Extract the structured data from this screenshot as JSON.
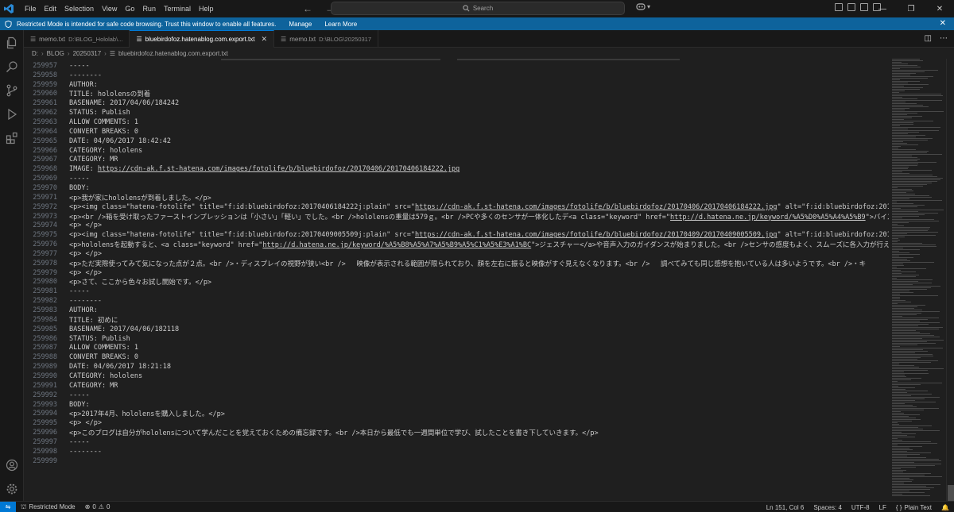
{
  "titlebar": {
    "menu": [
      "File",
      "Edit",
      "Selection",
      "View",
      "Go",
      "Run",
      "Terminal",
      "Help"
    ],
    "search_label": "Search"
  },
  "banner": {
    "text": "Restricted Mode is intended for safe code browsing. Trust this window to enable all features.",
    "manage": "Manage",
    "learn_more": "Learn More"
  },
  "tabs": [
    {
      "label": "memo.txt",
      "desc": "D:\\BLOG_Hololab\\...",
      "active": false
    },
    {
      "label": "bluebirdofoz.hatenablog.com.export.txt",
      "desc": "",
      "active": true
    },
    {
      "label": "memo.txt",
      "desc": "D:\\BLOG\\20250317",
      "active": false
    }
  ],
  "breadcrumb": [
    "D:",
    "BLOG",
    "20250317",
    "bluebirdofoz.hatenablog.com.export.txt"
  ],
  "editor": {
    "lines": [
      {
        "n": "259957",
        "t": "-----"
      },
      {
        "n": "259958",
        "t": "--------"
      },
      {
        "n": "259959",
        "t": "AUTHOR:"
      },
      {
        "n": "259960",
        "t": "TITLE: hololensの到着"
      },
      {
        "n": "259961",
        "t": "BASENAME: 2017/04/06/184242"
      },
      {
        "n": "259962",
        "t": "STATUS: Publish"
      },
      {
        "n": "259963",
        "t": "ALLOW COMMENTS: 1"
      },
      {
        "n": "259964",
        "t": "CONVERT BREAKS: 0"
      },
      {
        "n": "259965",
        "t": "DATE: 04/06/2017 18:42:42"
      },
      {
        "n": "259966",
        "t": "CATEGORY: hololens"
      },
      {
        "n": "259967",
        "t": "CATEGORY: MR"
      },
      {
        "n": "259968",
        "t": "IMAGE: https://cdn-ak.f.st-hatena.com/images/fotolife/b/bluebirdofoz/20170406/20170406184222.jpg"
      },
      {
        "n": "259969",
        "t": "-----"
      },
      {
        "n": "259970",
        "t": "BODY:"
      },
      {
        "n": "259971",
        "t": "<p>我が家にhololensが到着しました。</p>"
      },
      {
        "n": "259972",
        "t": "<p><img class=\"hatena-fotolife\" title=\"f:id:bluebirdofoz:20170406184222j:plain\" src=\"https://cdn-ak.f.st-hatena.com/images/fotolife/b/bluebirdofoz/20170406/20170406184222.jpg\" alt=\"f:id:bluebirdofoz:20170406184222j"
      },
      {
        "n": "259973",
        "t": "<p><br />箱を受け取ったファーストインプレッションは「小さい」「軽い」でした。<br />hololensの重量は579ｇ。<br />PCや多くのセンサが一体化したデ<a class=\"keyword\" href=\"http://d.hatena.ne.jp/keyword/%A5%D0%A5%A4%A5%B9\">バイス<"
      },
      {
        "n": "259974",
        "t": "<p> </p>"
      },
      {
        "n": "259975",
        "t": "<p><img class=\"hatena-fotolife\" title=\"f:id:bluebirdofoz:20170409005509j:plain\" src=\"https://cdn-ak.f.st-hatena.com/images/fotolife/b/bluebirdofoz/20170409/20170409005509.jpg\" alt=\"f:id:bluebirdofoz:20170409005509j"
      },
      {
        "n": "259976",
        "t": "<p>hololensを起動すると、<a class=\"keyword\" href=\"http://d.hatena.ne.jp/keyword/%A5%B8%A5%A7%A5%B9%A5%C1%A5%E3%A1%BC\">ジェスチャー</a>や音声入力のガイダンスが始まりました。<br />センサの感度もよく、スムーズに各入力が行えまし"
      },
      {
        "n": "259977",
        "t": "<p> </p>"
      },
      {
        "n": "259978",
        "t": "<p>ただ実際使ってみて気になった点が２点。<br />・ディスプレイの視野が狭い<br />　 映像が表示される範囲が限られており、顔を左右に振ると映像がすぐ見えなくなります。<br />　 調べてみても同じ感想を抱いている人は多いようです。<br />・キ"
      },
      {
        "n": "259979",
        "t": "<p> </p>"
      },
      {
        "n": "259980",
        "t": "<p>さて、ここから色々お試し開始です。</p>"
      },
      {
        "n": "259981",
        "t": "-----"
      },
      {
        "n": "259982",
        "t": "--------"
      },
      {
        "n": "259983",
        "t": "AUTHOR:"
      },
      {
        "n": "259984",
        "t": "TITLE: 初めに"
      },
      {
        "n": "259985",
        "t": "BASENAME: 2017/04/06/182118"
      },
      {
        "n": "259986",
        "t": "STATUS: Publish"
      },
      {
        "n": "259987",
        "t": "ALLOW COMMENTS: 1"
      },
      {
        "n": "259988",
        "t": "CONVERT BREAKS: 0"
      },
      {
        "n": "259989",
        "t": "DATE: 04/06/2017 18:21:18"
      },
      {
        "n": "259990",
        "t": "CATEGORY: hololens"
      },
      {
        "n": "259991",
        "t": "CATEGORY: MR"
      },
      {
        "n": "259992",
        "t": "-----"
      },
      {
        "n": "259993",
        "t": "BODY:"
      },
      {
        "n": "259994",
        "t": "<p>2017年4月、hololensを購入しました。</p>"
      },
      {
        "n": "259995",
        "t": "<p> </p>"
      },
      {
        "n": "259996",
        "t": "<p>このブログは自分がhololensについて学んだことを覚えておくための備忘録です。<br />本日から最低でも一週間単位で学び、試したことを書き下していきます。</p>"
      },
      {
        "n": "259997",
        "t": "-----"
      },
      {
        "n": "259998",
        "t": "--------"
      },
      {
        "n": "259999",
        "t": ""
      }
    ]
  },
  "statusbar": {
    "restricted": "Restricted Mode",
    "problems": "0",
    "warnings": "0",
    "position": "Ln 151, Col 6",
    "spaces": "Spaces: 4",
    "encoding": "UTF-8",
    "eol": "LF",
    "language": "Plain Text"
  },
  "colors": {
    "accent": "#0078d4",
    "banner": "#0e639c",
    "background": "#1f1f1f",
    "chrome": "#181818"
  }
}
